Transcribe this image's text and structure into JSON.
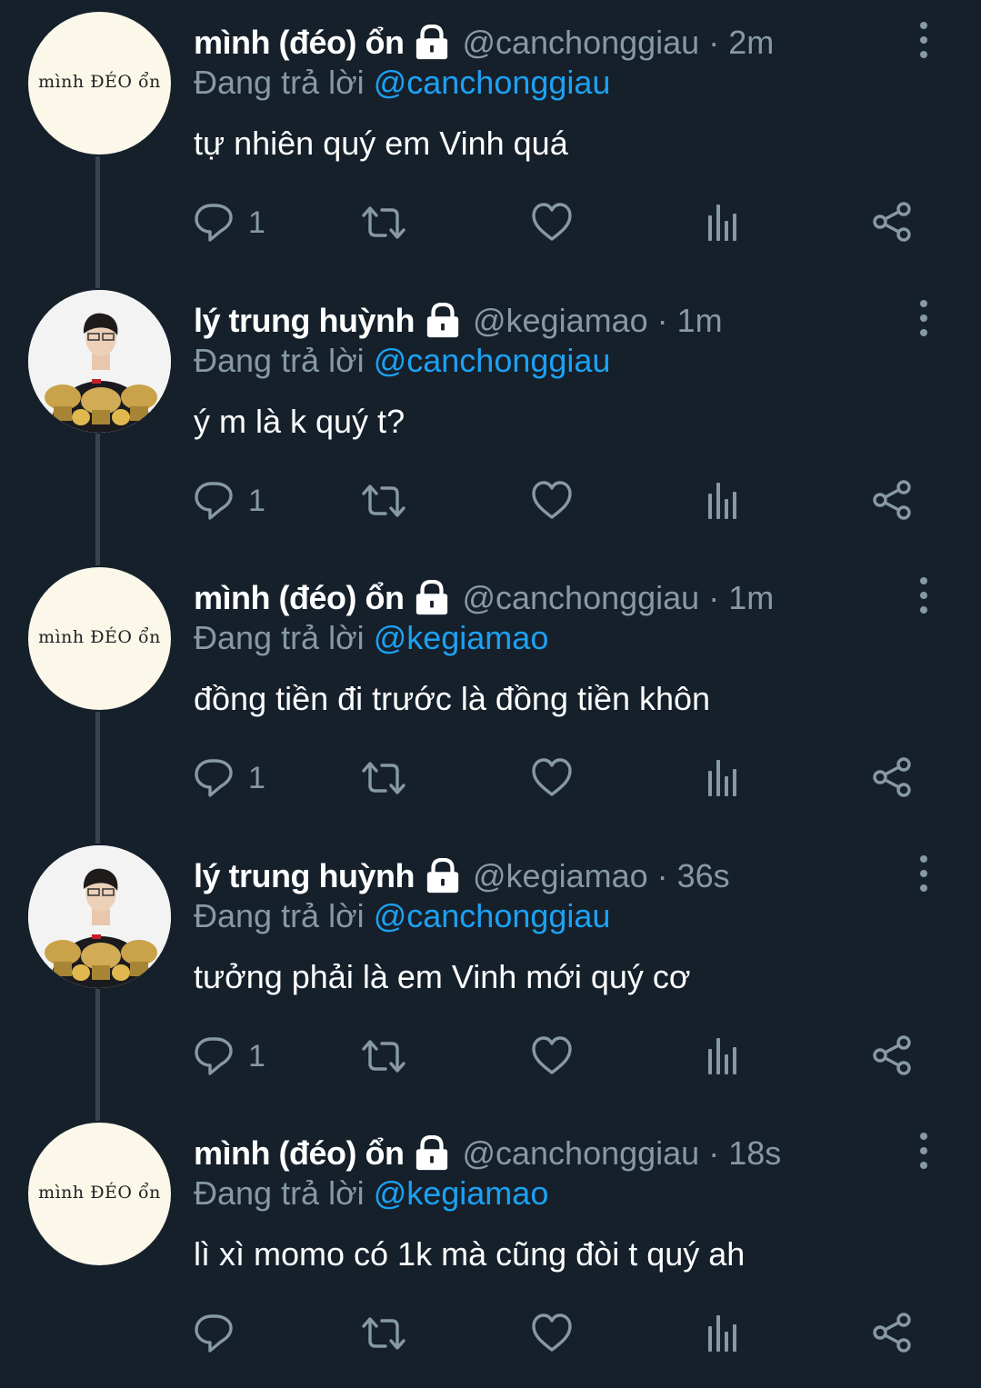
{
  "colors": {
    "background": "#15202b",
    "text_primary": "#ffffff",
    "text_secondary": "#8899a6",
    "link": "#1da1f2",
    "thread_line": "#38444d"
  },
  "reply_prefix": "Đang trả lời",
  "tweets": [
    {
      "avatar": "minh-deo-on-avatar",
      "avatar_text": "mình ĐÉO ổn",
      "name": "mình (đéo) ổn",
      "handle": "@canchonggiau",
      "time": "2m",
      "reply_to": "@canchonggiau",
      "text": "tự nhiên quý em Vinh quá",
      "reply_count": "1"
    },
    {
      "avatar": "ly-trung-huynh-avatar",
      "avatar_text": "",
      "name": "lý trung huỳnh",
      "handle": "@kegiamao",
      "time": "1m",
      "reply_to": "@canchonggiau",
      "text": "ý m là k quý t?",
      "reply_count": "1"
    },
    {
      "avatar": "minh-deo-on-avatar",
      "avatar_text": "mình ĐÉO ổn",
      "name": "mình (đéo) ổn",
      "handle": "@canchonggiau",
      "time": "1m",
      "reply_to": "@kegiamao",
      "text": "đồng tiền đi trước là đồng tiền khôn",
      "reply_count": "1"
    },
    {
      "avatar": "ly-trung-huynh-avatar",
      "avatar_text": "",
      "name": "lý trung huỳnh",
      "handle": "@kegiamao",
      "time": "36s",
      "reply_to": "@canchonggiau",
      "text": "tưởng phải là em Vinh mới quý cơ",
      "reply_count": "1"
    },
    {
      "avatar": "minh-deo-on-avatar",
      "avatar_text": "mình ĐÉO ổn",
      "name": "mình (đéo) ổn",
      "handle": "@canchonggiau",
      "time": "18s",
      "reply_to": "@kegiamao",
      "text": "lì xì momo có 1k mà cũng đòi t quý ah",
      "reply_count": ""
    }
  ]
}
